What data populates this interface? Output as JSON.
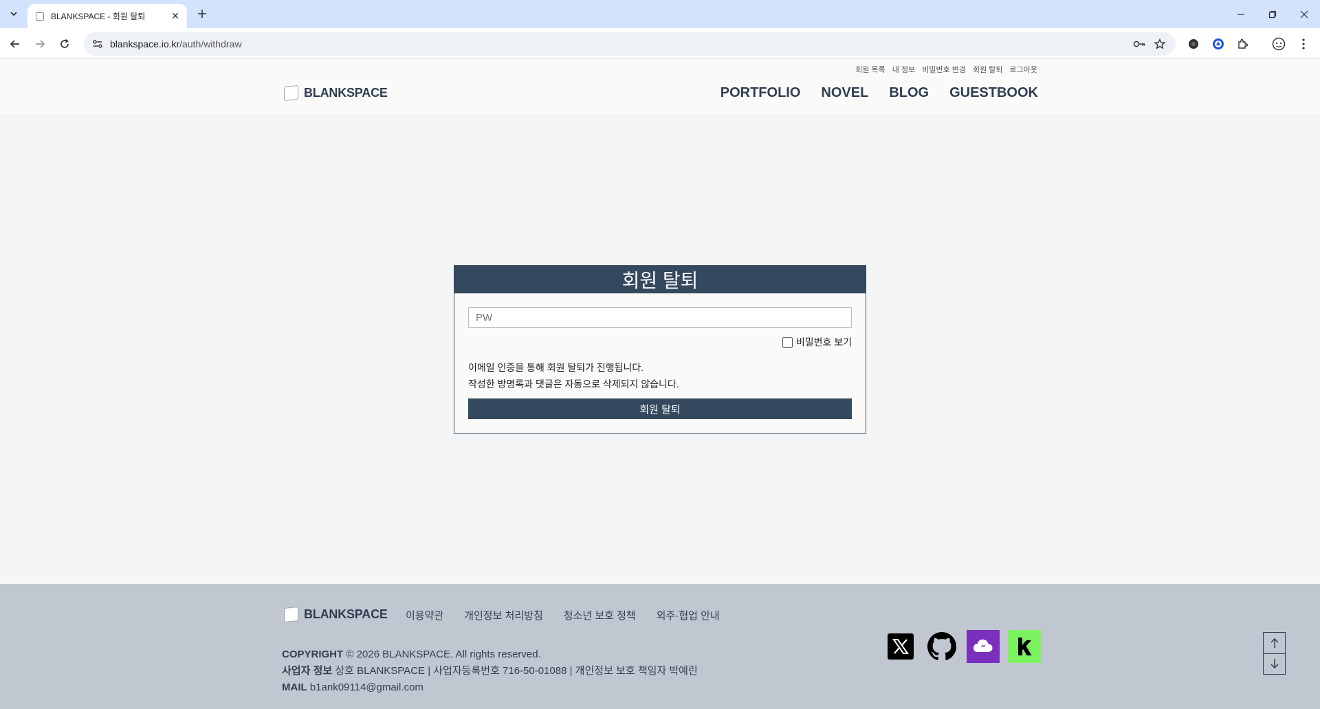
{
  "browser": {
    "tab_title": "BLANKSPACE - 회원 탈퇴",
    "url_host": "blankspace.io.kr",
    "url_path": "/auth/withdraw"
  },
  "header": {
    "logo_text": "BLANKSPACE",
    "user_menu": [
      "회원 목록",
      "내 정보",
      "비밀번호 변경",
      "회원 탈퇴",
      "로그아웃"
    ],
    "nav": [
      "PORTFOLIO",
      "NOVEL",
      "BLOG",
      "GUESTBOOK"
    ]
  },
  "withdraw": {
    "title": "회원 탈퇴",
    "pw_placeholder": "PW",
    "show_password_label": "비밀번호 보기",
    "notice_line1": "이메일 인증을 통해 회원 탈퇴가 진행됩니다.",
    "notice_line2": "작성한 방명록과 댓글은 자동으로 삭제되지 않습니다.",
    "submit_label": "회원 탈퇴"
  },
  "footer": {
    "logo_text": "BLANKSPACE",
    "links": [
      "이용약관",
      "개인정보 처리방침",
      "청소년 보호 정책",
      "외주·협업 안내"
    ],
    "copyright_label": "COPYRIGHT",
    "copyright_text": "© 2026 BLANKSPACE. All rights reserved.",
    "business_label": "사업자 정보",
    "business_text": "상호 BLANKSPACE | 사업자등록번호 716-50-01088 | 개인정보 보호 책임자 박예린",
    "mail_label": "MAIL",
    "mail_text": "b1ank09114@gmail.com",
    "social": [
      "x-icon",
      "github-icon",
      "chat-icon",
      "kakao-k-icon"
    ]
  },
  "colors": {
    "primary": "#34495e",
    "footer_bg": "#c1c7d0",
    "chat_purple": "#7b2fbe",
    "k_green": "#7cf260"
  }
}
